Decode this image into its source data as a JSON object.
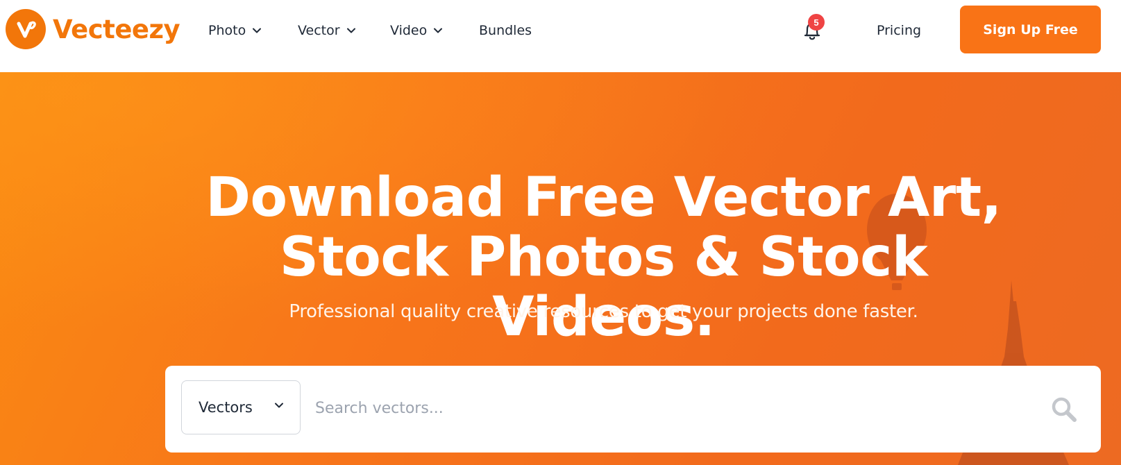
{
  "brand": {
    "name": "Vecteezy",
    "accent_color": "#f2760a"
  },
  "nav": {
    "items": [
      {
        "label": "Photo",
        "has_dropdown": true
      },
      {
        "label": "Vector",
        "has_dropdown": true
      },
      {
        "label": "Video",
        "has_dropdown": true
      },
      {
        "label": "Bundles",
        "has_dropdown": false
      }
    ],
    "notifications": {
      "icon": "bell-icon",
      "count": "5"
    },
    "pricing_label": "Pricing",
    "signup_label": "Sign Up Free"
  },
  "hero": {
    "title_line1": "Download Free Vector Art,",
    "title_line2": "Stock Photos & Stock Videos.",
    "subtitle": "Professional quality creative resources to get your projects done faster.",
    "background_color": "#f8761a"
  },
  "search": {
    "category": "Vectors",
    "placeholder": "Search vectors...",
    "icon": "search-icon"
  },
  "colors": {
    "cta": "#f97316",
    "badge": "#ef4444",
    "text": "#1f2937"
  }
}
